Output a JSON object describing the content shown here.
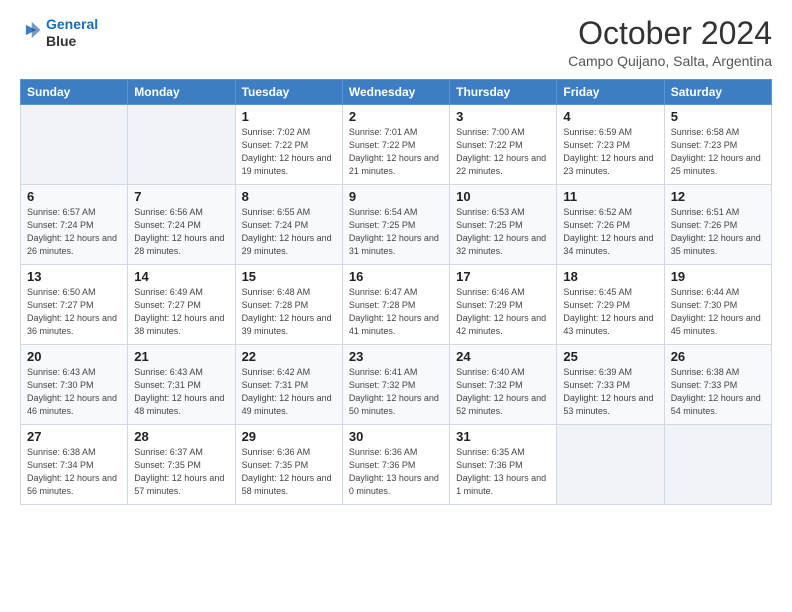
{
  "header": {
    "logo_line1": "General",
    "logo_line2": "Blue",
    "month_title": "October 2024",
    "location": "Campo Quijano, Salta, Argentina"
  },
  "weekdays": [
    "Sunday",
    "Monday",
    "Tuesday",
    "Wednesday",
    "Thursday",
    "Friday",
    "Saturday"
  ],
  "weeks": [
    [
      {
        "day": null
      },
      {
        "day": null
      },
      {
        "day": "1",
        "sunrise": "Sunrise: 7:02 AM",
        "sunset": "Sunset: 7:22 PM",
        "daylight": "Daylight: 12 hours and 19 minutes."
      },
      {
        "day": "2",
        "sunrise": "Sunrise: 7:01 AM",
        "sunset": "Sunset: 7:22 PM",
        "daylight": "Daylight: 12 hours and 21 minutes."
      },
      {
        "day": "3",
        "sunrise": "Sunrise: 7:00 AM",
        "sunset": "Sunset: 7:22 PM",
        "daylight": "Daylight: 12 hours and 22 minutes."
      },
      {
        "day": "4",
        "sunrise": "Sunrise: 6:59 AM",
        "sunset": "Sunset: 7:23 PM",
        "daylight": "Daylight: 12 hours and 23 minutes."
      },
      {
        "day": "5",
        "sunrise": "Sunrise: 6:58 AM",
        "sunset": "Sunset: 7:23 PM",
        "daylight": "Daylight: 12 hours and 25 minutes."
      }
    ],
    [
      {
        "day": "6",
        "sunrise": "Sunrise: 6:57 AM",
        "sunset": "Sunset: 7:24 PM",
        "daylight": "Daylight: 12 hours and 26 minutes."
      },
      {
        "day": "7",
        "sunrise": "Sunrise: 6:56 AM",
        "sunset": "Sunset: 7:24 PM",
        "daylight": "Daylight: 12 hours and 28 minutes."
      },
      {
        "day": "8",
        "sunrise": "Sunrise: 6:55 AM",
        "sunset": "Sunset: 7:24 PM",
        "daylight": "Daylight: 12 hours and 29 minutes."
      },
      {
        "day": "9",
        "sunrise": "Sunrise: 6:54 AM",
        "sunset": "Sunset: 7:25 PM",
        "daylight": "Daylight: 12 hours and 31 minutes."
      },
      {
        "day": "10",
        "sunrise": "Sunrise: 6:53 AM",
        "sunset": "Sunset: 7:25 PM",
        "daylight": "Daylight: 12 hours and 32 minutes."
      },
      {
        "day": "11",
        "sunrise": "Sunrise: 6:52 AM",
        "sunset": "Sunset: 7:26 PM",
        "daylight": "Daylight: 12 hours and 34 minutes."
      },
      {
        "day": "12",
        "sunrise": "Sunrise: 6:51 AM",
        "sunset": "Sunset: 7:26 PM",
        "daylight": "Daylight: 12 hours and 35 minutes."
      }
    ],
    [
      {
        "day": "13",
        "sunrise": "Sunrise: 6:50 AM",
        "sunset": "Sunset: 7:27 PM",
        "daylight": "Daylight: 12 hours and 36 minutes."
      },
      {
        "day": "14",
        "sunrise": "Sunrise: 6:49 AM",
        "sunset": "Sunset: 7:27 PM",
        "daylight": "Daylight: 12 hours and 38 minutes."
      },
      {
        "day": "15",
        "sunrise": "Sunrise: 6:48 AM",
        "sunset": "Sunset: 7:28 PM",
        "daylight": "Daylight: 12 hours and 39 minutes."
      },
      {
        "day": "16",
        "sunrise": "Sunrise: 6:47 AM",
        "sunset": "Sunset: 7:28 PM",
        "daylight": "Daylight: 12 hours and 41 minutes."
      },
      {
        "day": "17",
        "sunrise": "Sunrise: 6:46 AM",
        "sunset": "Sunset: 7:29 PM",
        "daylight": "Daylight: 12 hours and 42 minutes."
      },
      {
        "day": "18",
        "sunrise": "Sunrise: 6:45 AM",
        "sunset": "Sunset: 7:29 PM",
        "daylight": "Daylight: 12 hours and 43 minutes."
      },
      {
        "day": "19",
        "sunrise": "Sunrise: 6:44 AM",
        "sunset": "Sunset: 7:30 PM",
        "daylight": "Daylight: 12 hours and 45 minutes."
      }
    ],
    [
      {
        "day": "20",
        "sunrise": "Sunrise: 6:43 AM",
        "sunset": "Sunset: 7:30 PM",
        "daylight": "Daylight: 12 hours and 46 minutes."
      },
      {
        "day": "21",
        "sunrise": "Sunrise: 6:43 AM",
        "sunset": "Sunset: 7:31 PM",
        "daylight": "Daylight: 12 hours and 48 minutes."
      },
      {
        "day": "22",
        "sunrise": "Sunrise: 6:42 AM",
        "sunset": "Sunset: 7:31 PM",
        "daylight": "Daylight: 12 hours and 49 minutes."
      },
      {
        "day": "23",
        "sunrise": "Sunrise: 6:41 AM",
        "sunset": "Sunset: 7:32 PM",
        "daylight": "Daylight: 12 hours and 50 minutes."
      },
      {
        "day": "24",
        "sunrise": "Sunrise: 6:40 AM",
        "sunset": "Sunset: 7:32 PM",
        "daylight": "Daylight: 12 hours and 52 minutes."
      },
      {
        "day": "25",
        "sunrise": "Sunrise: 6:39 AM",
        "sunset": "Sunset: 7:33 PM",
        "daylight": "Daylight: 12 hours and 53 minutes."
      },
      {
        "day": "26",
        "sunrise": "Sunrise: 6:38 AM",
        "sunset": "Sunset: 7:33 PM",
        "daylight": "Daylight: 12 hours and 54 minutes."
      }
    ],
    [
      {
        "day": "27",
        "sunrise": "Sunrise: 6:38 AM",
        "sunset": "Sunset: 7:34 PM",
        "daylight": "Daylight: 12 hours and 56 minutes."
      },
      {
        "day": "28",
        "sunrise": "Sunrise: 6:37 AM",
        "sunset": "Sunset: 7:35 PM",
        "daylight": "Daylight: 12 hours and 57 minutes."
      },
      {
        "day": "29",
        "sunrise": "Sunrise: 6:36 AM",
        "sunset": "Sunset: 7:35 PM",
        "daylight": "Daylight: 12 hours and 58 minutes."
      },
      {
        "day": "30",
        "sunrise": "Sunrise: 6:36 AM",
        "sunset": "Sunset: 7:36 PM",
        "daylight": "Daylight: 13 hours and 0 minutes."
      },
      {
        "day": "31",
        "sunrise": "Sunrise: 6:35 AM",
        "sunset": "Sunset: 7:36 PM",
        "daylight": "Daylight: 13 hours and 1 minute."
      },
      {
        "day": null
      },
      {
        "day": null
      }
    ]
  ]
}
